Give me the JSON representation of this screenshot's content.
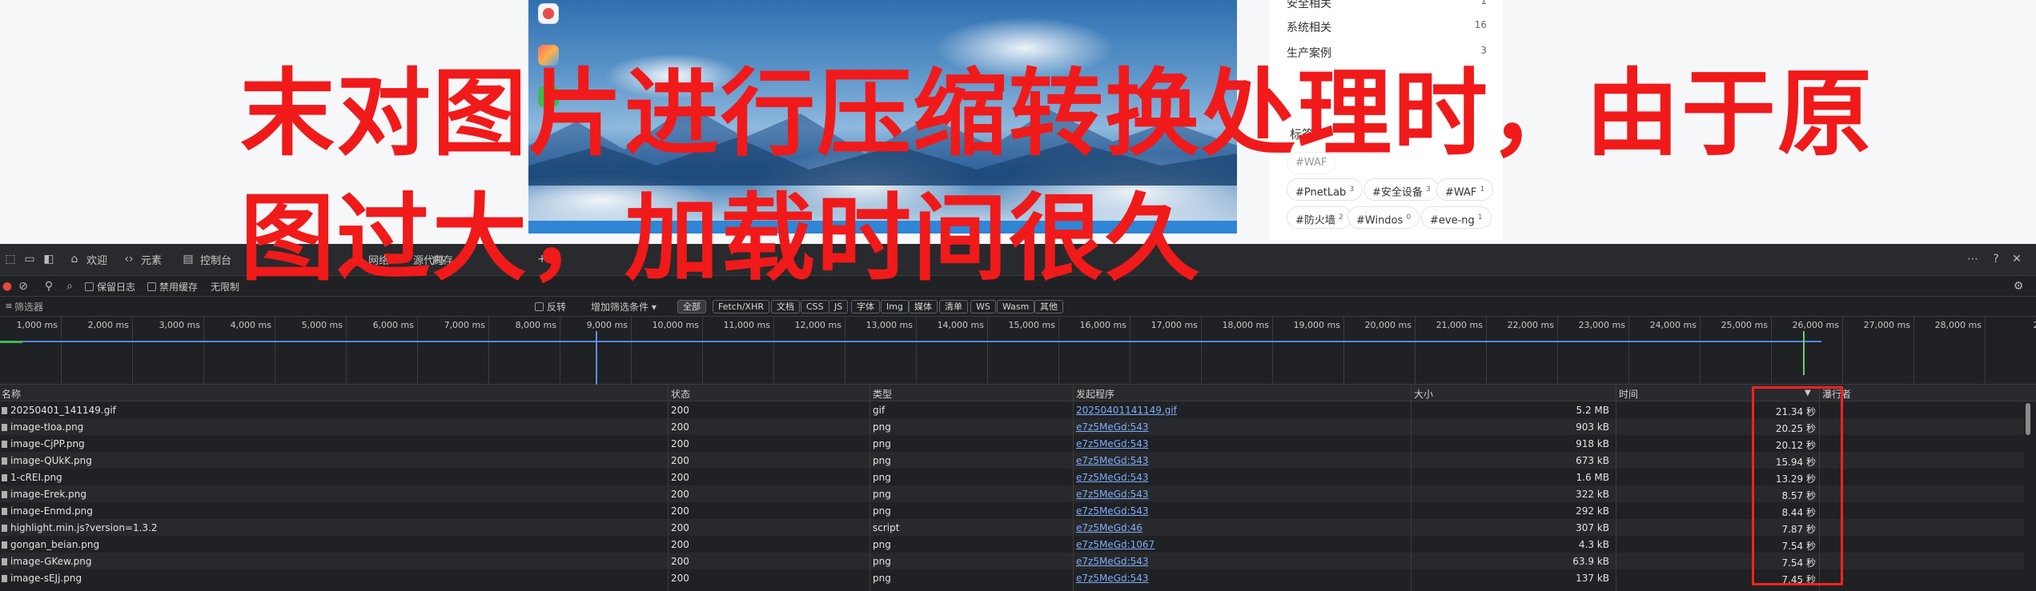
{
  "caption": {
    "line1": "末对图片进行压缩转换处理时，由于原",
    "line2": "图过大，加载时间很久"
  },
  "sidebar": {
    "categories": [
      {
        "label": "安全相关",
        "count": "1"
      },
      {
        "label": "系统相关",
        "count": "16"
      },
      {
        "label": "生产案例",
        "count": "3"
      }
    ],
    "tags_title": "标签",
    "tags": [
      {
        "label": "#PnetLab",
        "count": "3"
      },
      {
        "label": "#安全设备",
        "count": "3"
      },
      {
        "label": "#WAF",
        "count": "1"
      },
      {
        "label": "#防火墙",
        "count": "2"
      },
      {
        "label": "#Windos",
        "count": "0"
      },
      {
        "label": "#eve-ng",
        "count": "1"
      }
    ]
  },
  "devtools": {
    "tabs": [
      "欢迎",
      "元素",
      "控制台",
      "网络",
      "源代码",
      "内存"
    ],
    "toolbar": {
      "preserve_log": "保留日志",
      "disable_cache": "禁用缓存",
      "throttle": "无限制"
    },
    "filter": {
      "label": "筛选器",
      "invert": "反转",
      "more_filters": "增加筛选条件",
      "types": [
        "全部",
        "Fetch/XHR",
        "文档",
        "CSS",
        "JS",
        "字体",
        "Img",
        "媒体",
        "清单",
        "WS",
        "Wasm",
        "其他"
      ],
      "active_type": "全部"
    },
    "timeline": {
      "ticks": [
        "1,000 ms",
        "2,000 ms",
        "3,000 ms",
        "4,000 ms",
        "5,000 ms",
        "6,000 ms",
        "7,000 ms",
        "8,000 ms",
        "9,000 ms",
        "10,000 ms",
        "11,000 ms",
        "12,000 ms",
        "13,000 ms",
        "14,000 ms",
        "15,000 ms",
        "16,000 ms",
        "17,000 ms",
        "18,000 ms",
        "19,000 ms",
        "20,000 ms",
        "21,000 ms",
        "22,000 ms",
        "23,000 ms",
        "24,000 ms",
        "25,000 ms",
        "26,000 ms",
        "27,000 ms",
        "28,000 ms",
        "29,0"
      ]
    },
    "table": {
      "headers": {
        "name": "名称",
        "status": "状态",
        "type": "类型",
        "initiator": "发起程序",
        "size": "大小",
        "time": "时间",
        "waterfall": "瀑行者"
      },
      "rows": [
        {
          "name": "20250401_141149.gif",
          "status": "200",
          "type": "gif",
          "initiator": "20250401141149.gif",
          "size": "5.2 MB",
          "time": "21.34 秒"
        },
        {
          "name": "image-tIoa.png",
          "status": "200",
          "type": "png",
          "initiator": "e7z5MeGd:543",
          "size": "903 kB",
          "time": "20.25 秒"
        },
        {
          "name": "image-CjPP.png",
          "status": "200",
          "type": "png",
          "initiator": "e7z5MeGd:543",
          "size": "918 kB",
          "time": "20.12 秒"
        },
        {
          "name": "image-QUkK.png",
          "status": "200",
          "type": "png",
          "initiator": "e7z5MeGd:543",
          "size": "673 kB",
          "time": "15.94 秒"
        },
        {
          "name": "1-cREI.png",
          "status": "200",
          "type": "png",
          "initiator": "e7z5MeGd:543",
          "size": "1.6 MB",
          "time": "13.29 秒"
        },
        {
          "name": "image-Erek.png",
          "status": "200",
          "type": "png",
          "initiator": "e7z5MeGd:543",
          "size": "322 kB",
          "time": "8.57 秒"
        },
        {
          "name": "image-Enmd.png",
          "status": "200",
          "type": "png",
          "initiator": "e7z5MeGd:543",
          "size": "292 kB",
          "time": "8.44 秒"
        },
        {
          "name": "highlight.min.js?version=1.3.2",
          "status": "200",
          "type": "script",
          "initiator": "e7z5MeGd:46",
          "size": "307 kB",
          "time": "7.87 秒"
        },
        {
          "name": "gongan_beian.png",
          "status": "200",
          "type": "png",
          "initiator": "e7z5MeGd:1067",
          "size": "4.3 kB",
          "time": "7.54 秒"
        },
        {
          "name": "image-GKew.png",
          "status": "200",
          "type": "png",
          "initiator": "e7z5MeGd:543",
          "size": "63.9 kB",
          "time": "7.54 秒"
        },
        {
          "name": "image-sEJj.png",
          "status": "200",
          "type": "png",
          "initiator": "e7z5MeGd:543",
          "size": "137 kB",
          "time": "7.45 秒"
        }
      ]
    }
  },
  "colors": {
    "caption": "#f01a1a",
    "highlight_box": "#ff2020",
    "link": "#7cacf8",
    "devtools_bg": "#202124"
  }
}
